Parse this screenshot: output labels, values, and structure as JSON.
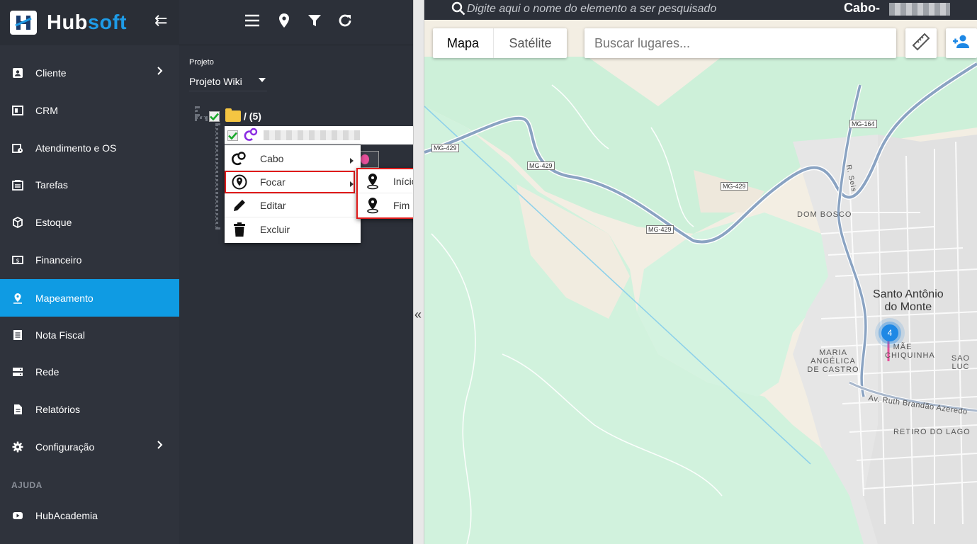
{
  "app": {
    "brand_part1": "Hub",
    "brand_part2": "soft",
    "accent_color": "#0f9be3"
  },
  "sidebar": {
    "items": [
      {
        "label": "Cliente",
        "icon": "id-card-icon",
        "has_submenu": true
      },
      {
        "label": "CRM",
        "icon": "crm-icon",
        "has_submenu": false
      },
      {
        "label": "Atendimento e OS",
        "icon": "calendar-clock-icon",
        "has_submenu": false
      },
      {
        "label": "Tarefas",
        "icon": "tasks-icon",
        "has_submenu": false
      },
      {
        "label": "Estoque",
        "icon": "box-icon",
        "has_submenu": false
      },
      {
        "label": "Financeiro",
        "icon": "money-icon",
        "has_submenu": false
      },
      {
        "label": "Mapeamento",
        "icon": "map-pin-icon",
        "has_submenu": false,
        "active": true
      },
      {
        "label": "Nota Fiscal",
        "icon": "receipt-icon",
        "has_submenu": false
      },
      {
        "label": "Rede",
        "icon": "server-icon",
        "has_submenu": false
      },
      {
        "label": "Relatórios",
        "icon": "report-icon",
        "has_submenu": false
      },
      {
        "label": "Configuração",
        "icon": "gear-icon",
        "has_submenu": true
      }
    ],
    "section_help": "AJUDA",
    "help_items": [
      {
        "label": "HubAcademia",
        "icon": "youtube-icon"
      }
    ]
  },
  "panel": {
    "toolbar_icons": [
      "menu-icon",
      "location-icon",
      "filter-icon",
      "refresh-icon"
    ],
    "project_label": "Projeto",
    "project_value": "Projeto Wiki",
    "tree_root_label": "/ (5)"
  },
  "context_menu": {
    "items": [
      {
        "label": "Cabo",
        "icon": "cable-icon",
        "has_submenu": true
      },
      {
        "label": "Focar",
        "icon": "target-pin-icon",
        "has_submenu": true
      },
      {
        "label": "Editar",
        "icon": "pencil-icon",
        "has_submenu": false
      },
      {
        "label": "Excluir",
        "icon": "trash-icon",
        "has_submenu": false
      }
    ],
    "submenu_items": [
      {
        "label": "Início",
        "icon": "map-marker-icon"
      },
      {
        "label": "Fim",
        "icon": "map-marker-icon"
      }
    ]
  },
  "map": {
    "search_placeholder": "Digite aqui o nome do elemento a ser pesquisado",
    "title": "Cabo-",
    "type_map": "Mapa",
    "type_satellite": "Satélite",
    "places_placeholder": "Buscar lugares...",
    "road_shields": [
      "MG-429",
      "MG-429",
      "MG-429",
      "MG-429",
      "MG-164"
    ],
    "street_name": "R. Seis",
    "street_name_2": "Av. Ruth Brandão Azeredo",
    "places": [
      "DOM BOSCO",
      "MARIA ANGÉLICA DE CASTRO",
      "MÃE CHIQUINHA",
      "SAO LUC",
      "RETIRO DO LAGO"
    ],
    "city_line1": "Santo Antônio",
    "city_line2": "do Monte",
    "cluster_count": "4"
  }
}
